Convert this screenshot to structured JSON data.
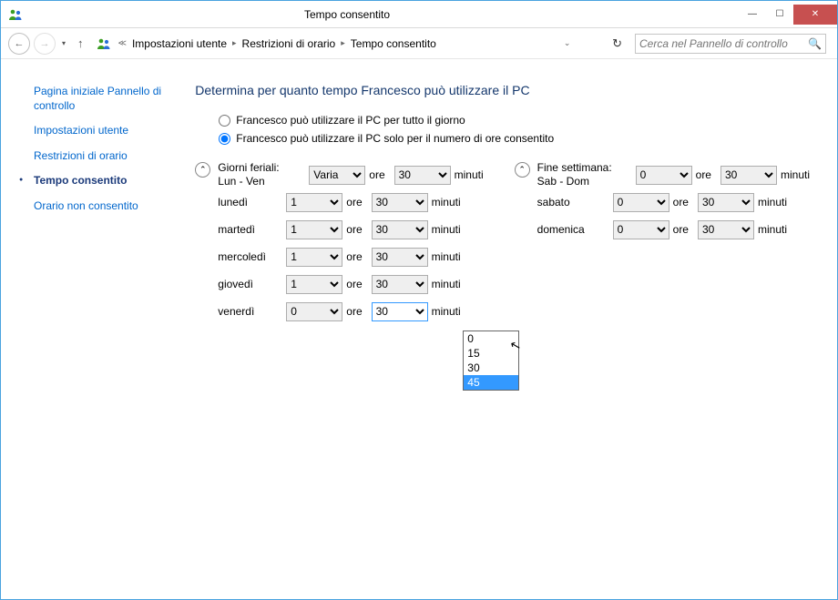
{
  "window": {
    "title": "Tempo consentito"
  },
  "breadcrumb": {
    "items": [
      "Impostazioni utente",
      "Restrizioni di orario",
      "Tempo consentito"
    ]
  },
  "search": {
    "placeholder": "Cerca nel Pannello di controllo"
  },
  "sidebar": {
    "items": [
      {
        "label": "Pagina iniziale Pannello di controllo",
        "current": false
      },
      {
        "label": "Impostazioni utente",
        "current": false
      },
      {
        "label": "Restrizioni di orario",
        "current": false
      },
      {
        "label": "Tempo consentito",
        "current": true
      },
      {
        "label": "Orario non consentito",
        "current": false
      }
    ]
  },
  "heading": "Determina per quanto tempo Francesco può utilizzare il PC",
  "radios": {
    "opt1": "Francesco può utilizzare il PC per tutto il giorno",
    "opt2": "Francesco può utilizzare il PC solo per il numero di ore consentito",
    "selected": "opt2"
  },
  "units": {
    "hours": "ore",
    "minutes": "minuti"
  },
  "weekdays": {
    "header_label": "Giorni feriali:\nLun - Ven",
    "header_hours": "Varia",
    "header_minutes": "30",
    "days": [
      {
        "name": "lunedì",
        "hours": "1",
        "minutes": "30"
      },
      {
        "name": "martedì",
        "hours": "1",
        "minutes": "30"
      },
      {
        "name": "mercoledì",
        "hours": "1",
        "minutes": "30"
      },
      {
        "name": "giovedì",
        "hours": "1",
        "minutes": "30"
      },
      {
        "name": "venerdì",
        "hours": "0",
        "minutes": "30"
      }
    ]
  },
  "weekend": {
    "header_label": "Fine settimana:\nSab - Dom",
    "header_hours": "0",
    "header_minutes": "30",
    "days": [
      {
        "name": "sabato",
        "hours": "0",
        "minutes": "30"
      },
      {
        "name": "domenica",
        "hours": "0",
        "minutes": "30"
      }
    ]
  },
  "dropdown": {
    "options": [
      "0",
      "15",
      "30",
      "45"
    ],
    "highlighted": 3
  }
}
